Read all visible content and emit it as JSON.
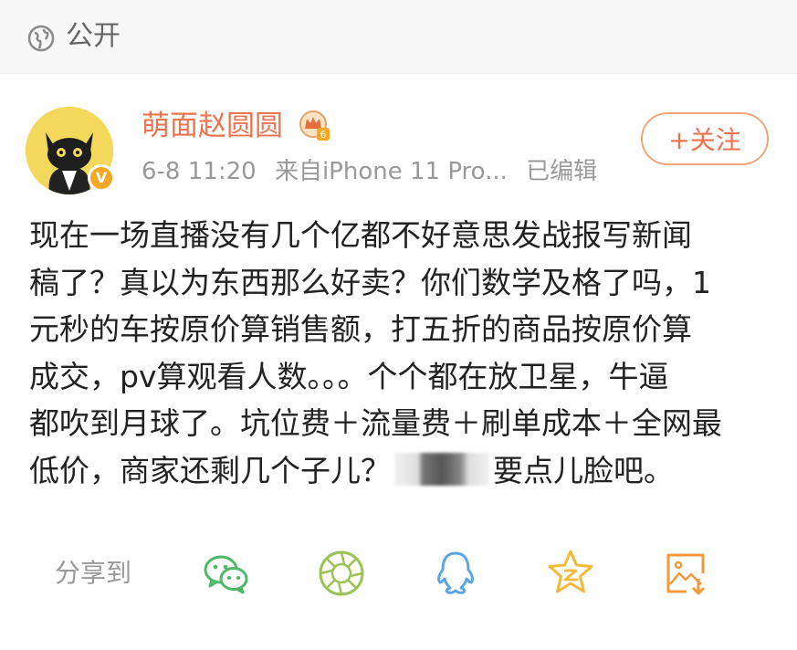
{
  "privacy": {
    "label": "公开",
    "icon": "globe-icon"
  },
  "author": {
    "name": "萌面赵圆圆",
    "verified_mark": "V",
    "vip_badge_icon": "crown-badge-icon",
    "vip_level": "6"
  },
  "meta": {
    "time": "6-8 11:20",
    "source": "来自iPhone 11 Pro...",
    "edited": "已编辑"
  },
  "follow_button": {
    "label": "+关注"
  },
  "post": {
    "lines": [
      "现在一场直播没有几个亿都不好意思发战报写新闻",
      "稿了？真以为东西那么好卖？你们数学及格了吗，1",
      "元秒的车按原价算销售额，打五折的商品按原价算",
      "成交，pv算观看人数。。。个个都在放卫星，牛逼",
      "都吹到月球了。坑位费＋流量费＋刷单成本＋全网最"
    ],
    "last_line_before": "低价，商家还剩几个子儿？",
    "last_line_after": "要点儿脸吧。"
  },
  "share": {
    "label": "分享到",
    "icons": [
      "wechat-icon",
      "moments-icon",
      "qq-icon",
      "qzone-icon",
      "save-image-icon"
    ]
  },
  "colors": {
    "accent": "#eb7350",
    "wechat": "#4cb868",
    "moments": "#9bc255",
    "qq": "#5aa4e6",
    "qzone": "#f5b93a",
    "save": "#f29a38"
  }
}
